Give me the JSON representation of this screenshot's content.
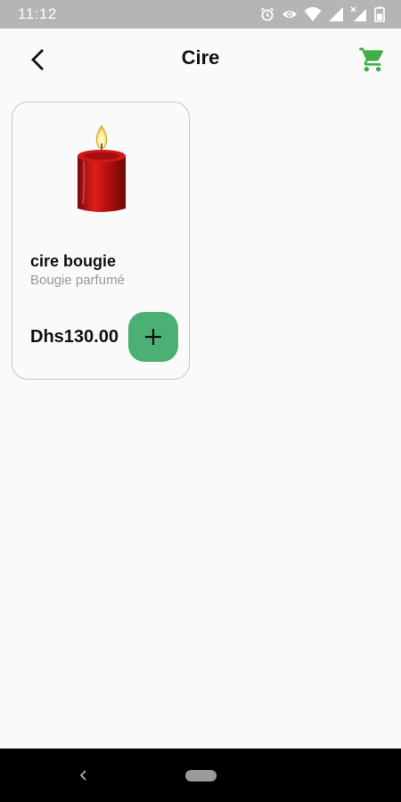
{
  "status_bar": {
    "time": "11:12",
    "icons": [
      "alarm-icon",
      "eye-icon",
      "wifi-icon",
      "signal-icon",
      "signal-no-data-icon",
      "battery-icon"
    ]
  },
  "app_bar": {
    "title": "Cire",
    "back_icon": "back-arrow-icon",
    "cart_icon": "cart-icon",
    "accent_color": "#3db04b"
  },
  "products": [
    {
      "name": "cire bougie",
      "subtitle": "Bougie parfumé",
      "price": "Dhs130.00",
      "image": "red-candle",
      "add_icon": "plus-icon",
      "add_button_color": "#4caf73"
    }
  ],
  "nav_bar": {
    "icons": [
      "nav-back-icon",
      "home-pill-icon"
    ]
  }
}
